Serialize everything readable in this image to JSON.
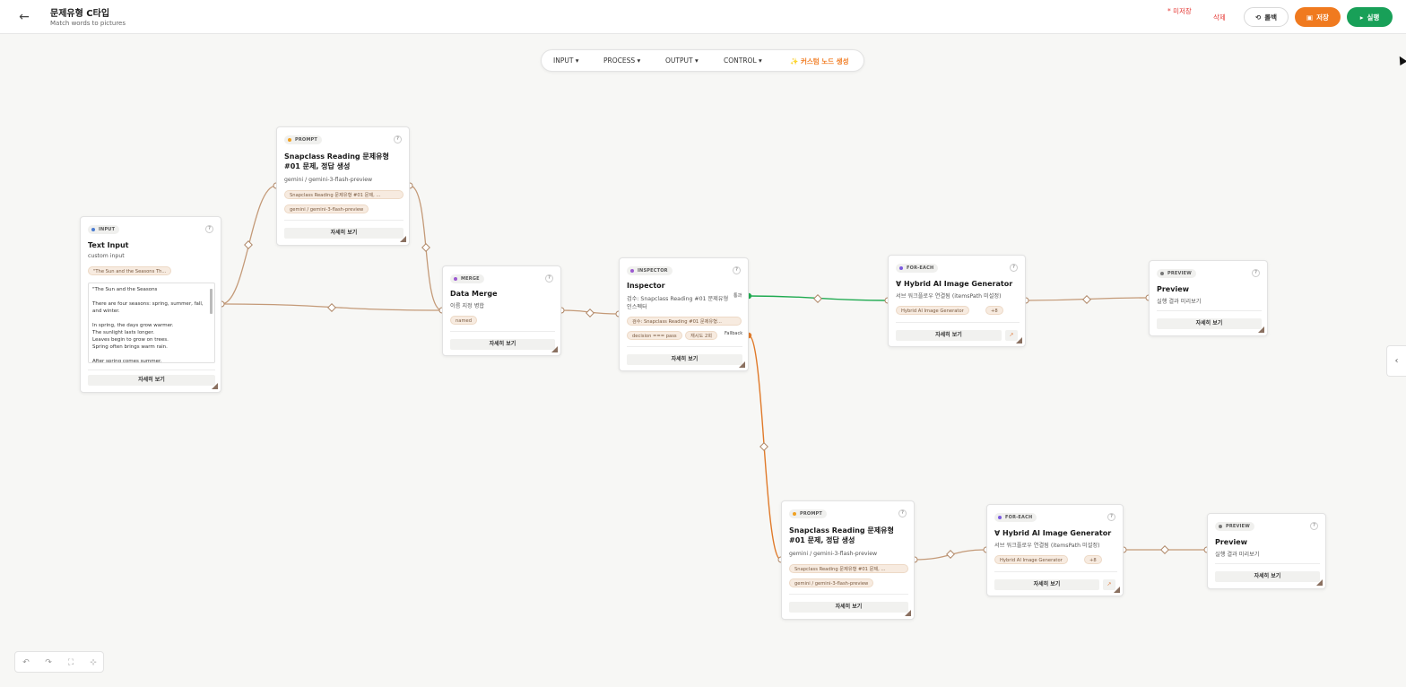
{
  "header": {
    "title": "문제유형 C타입",
    "subtitle": "Match words to pictures",
    "unsaved": "* 미저장",
    "delete_label": "삭제",
    "history_label": "롤백",
    "save_label": "저장",
    "run_label": "실행"
  },
  "toolbar": {
    "input": "INPUT ▾",
    "process": "PROCESS ▾",
    "output": "OUTPUT ▾",
    "control": "CONTROL ▾",
    "custom": "✨ 커스텀 노드 생성"
  },
  "colors": {
    "accent": "#f07a1f",
    "run": "#18a058",
    "danger": "#e53935",
    "edge": "#c49a78",
    "edge_green": "#1faa50",
    "edge_orange": "#e07a2a",
    "dot_input": "#4a7bd1",
    "dot_prompt": "#f0a020",
    "dot_merge": "#9b59d0",
    "dot_inspector": "#9b59d0",
    "dot_foreach": "#7b5ae0",
    "dot_preview": "#777777"
  },
  "nodes": {
    "text_input": {
      "tag": "INPUT",
      "title": "Text Input",
      "subtitle": "custom input",
      "chip": "\"The Sun and the Seasons Th...",
      "content": "\"The Sun and the Seasons\n\nThere are four seasons: spring, summer, fall, and winter.\n\nIn spring, the days grow warmer.\nThe sunlight lasts longer.\nLeaves begin to grow on trees.\nSpring often brings warm rain.\n\nAfter spring comes summer.",
      "detail": "자세히 보기"
    },
    "prompt_1": {
      "tag": "PROMPT",
      "title": "Snapclass Reading 문제유형 #01 문제, 정답 생성",
      "subtitle": "gemini / gemini-3-flash-preview",
      "chip1": "Snapclass Reading 문제유형 #01 문제, ...",
      "chip2": "gemini / gemini-3-flash-preview",
      "detail": "자세히 보기"
    },
    "merge": {
      "tag": "MERGE",
      "title": "Data Merge",
      "subtitle": "이름 지정 병합",
      "chip": "named",
      "detail": "자세히 보기"
    },
    "inspector": {
      "tag": "INSPECTOR",
      "title": "Inspector",
      "subtitle1": "검수: Snapclass Reading #01 문제유형",
      "subtitle2": "인스펙터",
      "chip1": "검수: Snapclass Reading #01 문제유형...",
      "chip2": "decision === pass",
      "chip3": "재시도 2회",
      "label_pass": "통과",
      "label_fallback": "Fallback",
      "detail": "자세히 보기"
    },
    "foreach_1": {
      "tag": "FOR-EACH",
      "title": "∀ Hybrid AI Image Generator",
      "subtitle": "서브 워크플로우 연결됨 (itemsPath 미설정)",
      "chip1": "Hybrid AI Image Generator",
      "chip2": "+8",
      "detail": "자세히 보기",
      "ext_icon": "↗"
    },
    "preview_1": {
      "tag": "PREVIEW",
      "title": "Preview",
      "subtitle": "실행 결과 미리보기",
      "detail": "자세히 보기"
    },
    "prompt_2": {
      "tag": "PROMPT",
      "title": "Snapclass Reading 문제유형 #01 문제, 정답 생성",
      "subtitle": "gemini / gemini-3-flash-preview",
      "chip1": "Snapclass Reading 문제유형 #01 문제, ...",
      "chip2": "gemini / gemini-3-flash-preview",
      "detail": "자세히 보기"
    },
    "foreach_2": {
      "tag": "FOR-EACH",
      "title": "∀ Hybrid AI Image Generator",
      "subtitle": "서브 워크플로우 연결됨 (itemsPath 미설정)",
      "chip1": "Hybrid AI Image Generator",
      "chip2": "+8",
      "detail": "자세히 보기",
      "ext_icon": "↗"
    },
    "preview_2": {
      "tag": "PREVIEW",
      "title": "Preview",
      "subtitle": "실행 결과 미리보기",
      "detail": "자세히 보기"
    }
  },
  "controls": {
    "undo": "↶",
    "redo": "↷",
    "fit": "⛶",
    "focus": "⊹"
  },
  "side_toggle": "‹",
  "cursor": "▲"
}
